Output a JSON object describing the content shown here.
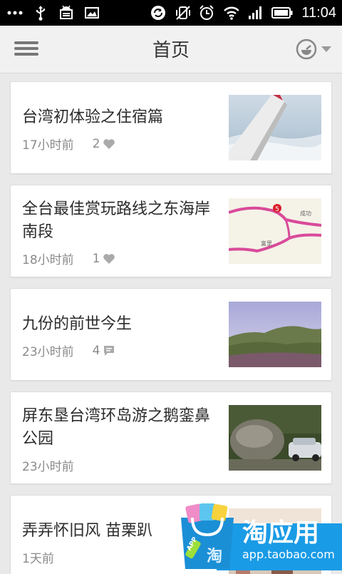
{
  "statusbar": {
    "time": "11:04",
    "left_icons": [
      "more-dots-icon",
      "usb-icon",
      "android-debug-icon",
      "image-icon"
    ],
    "right_icons": [
      "sync-icon",
      "vibrate-off-icon",
      "alarm-icon",
      "wifi-icon",
      "signal-icon",
      "battery-icon"
    ]
  },
  "appbar": {
    "title": "首页",
    "menu_icon": "hamburger-menu-icon",
    "history_icon": "clock-icon"
  },
  "feed": [
    {
      "title": "台湾初体验之住宿篇",
      "time": "17小时前",
      "count": "2",
      "count_icon": "heart-icon",
      "thumb": "airplane-wing-photo"
    },
    {
      "title": "全台最佳赏玩路线之东海岸南段",
      "time": "18小时前",
      "count": "1",
      "count_icon": "heart-icon",
      "thumb": "route-map-photo",
      "map_labels": {
        "route": "5",
        "city1": "成功",
        "city2": "富里"
      }
    },
    {
      "title": "九份的前世今生",
      "time": "23小时前",
      "count": "4",
      "count_icon": "comment-icon",
      "thumb": "mountain-landscape-photo"
    },
    {
      "title": "屏东垦台湾环岛游之鹅銮鼻公园",
      "time": "23小时前",
      "count": "",
      "count_icon": "",
      "thumb": "rock-park-photo"
    },
    {
      "title": "弄弄怀旧风 苗栗趴",
      "time": "1天前",
      "count": "",
      "count_icon": "",
      "thumb": "street-photo"
    }
  ],
  "badge": {
    "name": "淘应用",
    "url": "app.taobao.com",
    "bag_text": "淘",
    "tag_text": "APP"
  },
  "colors": {
    "status_bar": "#000000",
    "app_bar": "#f1f1f1",
    "background": "#e9e9e9",
    "badge_blue": "#1a9be6"
  }
}
